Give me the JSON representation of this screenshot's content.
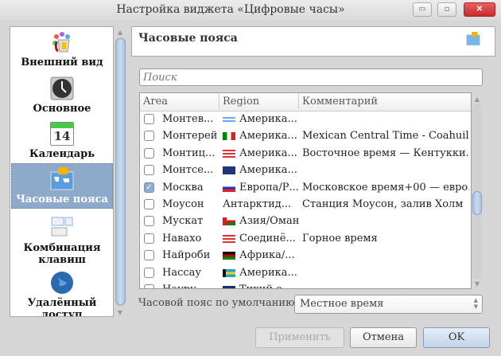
{
  "window": {
    "title": "Настройка виджета «Цифровые часы»",
    "minimize": "▭",
    "maximize": "▫",
    "close": "✕"
  },
  "sidebar": {
    "items": [
      {
        "label": "Внешний вид",
        "icon": "paint-bucket-icon"
      },
      {
        "label": "Основное",
        "icon": "clock-icon"
      },
      {
        "label": "Календарь",
        "icon": "calendar-icon",
        "icon_text": "14"
      },
      {
        "label": "Часовые пояса",
        "icon": "world-map-icon",
        "selected": true
      },
      {
        "label": "Комбинация клавиш",
        "icon": "keyboard-icon"
      },
      {
        "label": "Удалённый доступ",
        "icon": "globe-icon"
      }
    ]
  },
  "header": {
    "title": "Часовые пояса"
  },
  "search": {
    "placeholder": "Поиск",
    "value": ""
  },
  "table": {
    "columns": [
      "Area",
      "Region",
      "Комментарий"
    ],
    "rows": [
      {
        "area": "Монтев...",
        "region": "Америка...",
        "comment": "",
        "flag": "uy",
        "checked": false
      },
      {
        "area": "Монтерей",
        "region": "Америка...",
        "comment": "Mexican Central Time - Coahuil...",
        "flag": "mx",
        "checked": false
      },
      {
        "area": "Монтиц...",
        "region": "Америка...",
        "comment": "Восточное время — Кентукки...",
        "flag": "us",
        "checked": false
      },
      {
        "area": "Монтсе...",
        "region": "Америка...",
        "comment": "",
        "flag": "ms",
        "checked": false
      },
      {
        "area": "Москва",
        "region": "Европа/Р...",
        "comment": "Московское время+00 — евро...",
        "flag": "ru",
        "checked": true
      },
      {
        "area": "Моусон",
        "region": "Антарктид...",
        "comment": "Станция Моусон, залив Холм",
        "flag": "",
        "checked": false
      },
      {
        "area": "Мускат",
        "region": "Азия/Оман",
        "comment": "",
        "flag": "om",
        "checked": false
      },
      {
        "area": "Навахо",
        "region": "Соединё...",
        "comment": "Горное время",
        "flag": "us",
        "checked": false
      },
      {
        "area": "Найроби",
        "region": "Африка/...",
        "comment": "",
        "flag": "ke",
        "checked": false
      },
      {
        "area": "Нассау",
        "region": "Америка...",
        "comment": "",
        "flag": "bs",
        "checked": false
      },
      {
        "area": "Науру",
        "region": "Тихий о...",
        "comment": "",
        "flag": "nr",
        "checked": false
      }
    ]
  },
  "default_tz": {
    "label": "Часовой пояс по умолчанию:",
    "value": "Местное время"
  },
  "buttons": {
    "apply": "Применить",
    "cancel": "Отмена",
    "ok": "OK"
  }
}
